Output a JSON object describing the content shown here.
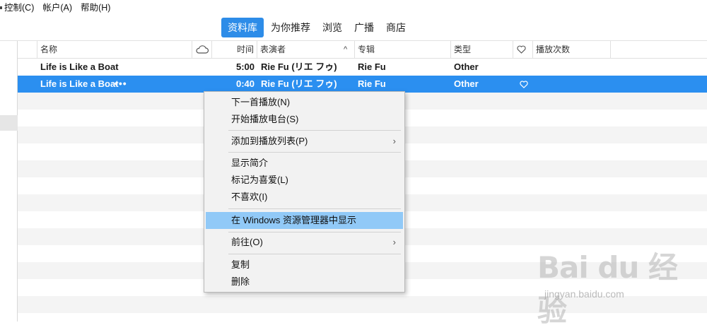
{
  "menubar": {
    "items": [
      "控制(C)",
      "帐户(A)",
      "帮助(H)"
    ]
  },
  "tabs": [
    {
      "label": "资料库",
      "active": true
    },
    {
      "label": "为你推荐",
      "active": false
    },
    {
      "label": "浏览",
      "active": false
    },
    {
      "label": "广播",
      "active": false
    },
    {
      "label": "商店",
      "active": false
    }
  ],
  "table": {
    "columns": {
      "name": "名称",
      "time": "时间",
      "artist": "表演者",
      "album": "专辑",
      "genre": "类型",
      "plays": "播放次数"
    },
    "rows": [
      {
        "name": "Life is Like a Boat",
        "time": "5:00",
        "artist": "Rie Fu (リエ フゥ)",
        "album": "Rie Fu",
        "genre": "Other",
        "loved": false,
        "selected": false
      },
      {
        "name": "Life is Like a Boat",
        "more": "•••",
        "time": "0:40",
        "artist": "Rie Fu (リエ フゥ)",
        "album": "Rie Fu",
        "genre": "Other",
        "loved": true,
        "selected": true
      }
    ]
  },
  "context_menu": {
    "items": [
      {
        "label": "下一首播放(N)"
      },
      {
        "label": "开始播放电台(S)"
      },
      {
        "label": "添加到播放列表(P)",
        "submenu": true
      },
      {
        "label": "显示简介"
      },
      {
        "label": "标记为喜爱(L)"
      },
      {
        "label": "不喜欢(I)"
      },
      {
        "label": "在 Windows 资源管理器中显示",
        "highlighted": true
      },
      {
        "label": "前往(O)",
        "submenu": true
      },
      {
        "label": "复制"
      },
      {
        "label": "删除"
      }
    ],
    "submenu_arrow": "›"
  },
  "watermark": {
    "logo": "Bai du 经验",
    "url": "jingyan.baidu.com"
  },
  "colors": {
    "accent": "#2d8ce8",
    "selected_row": "#2b8ff0",
    "menu_highlight": "#91c9f7"
  }
}
